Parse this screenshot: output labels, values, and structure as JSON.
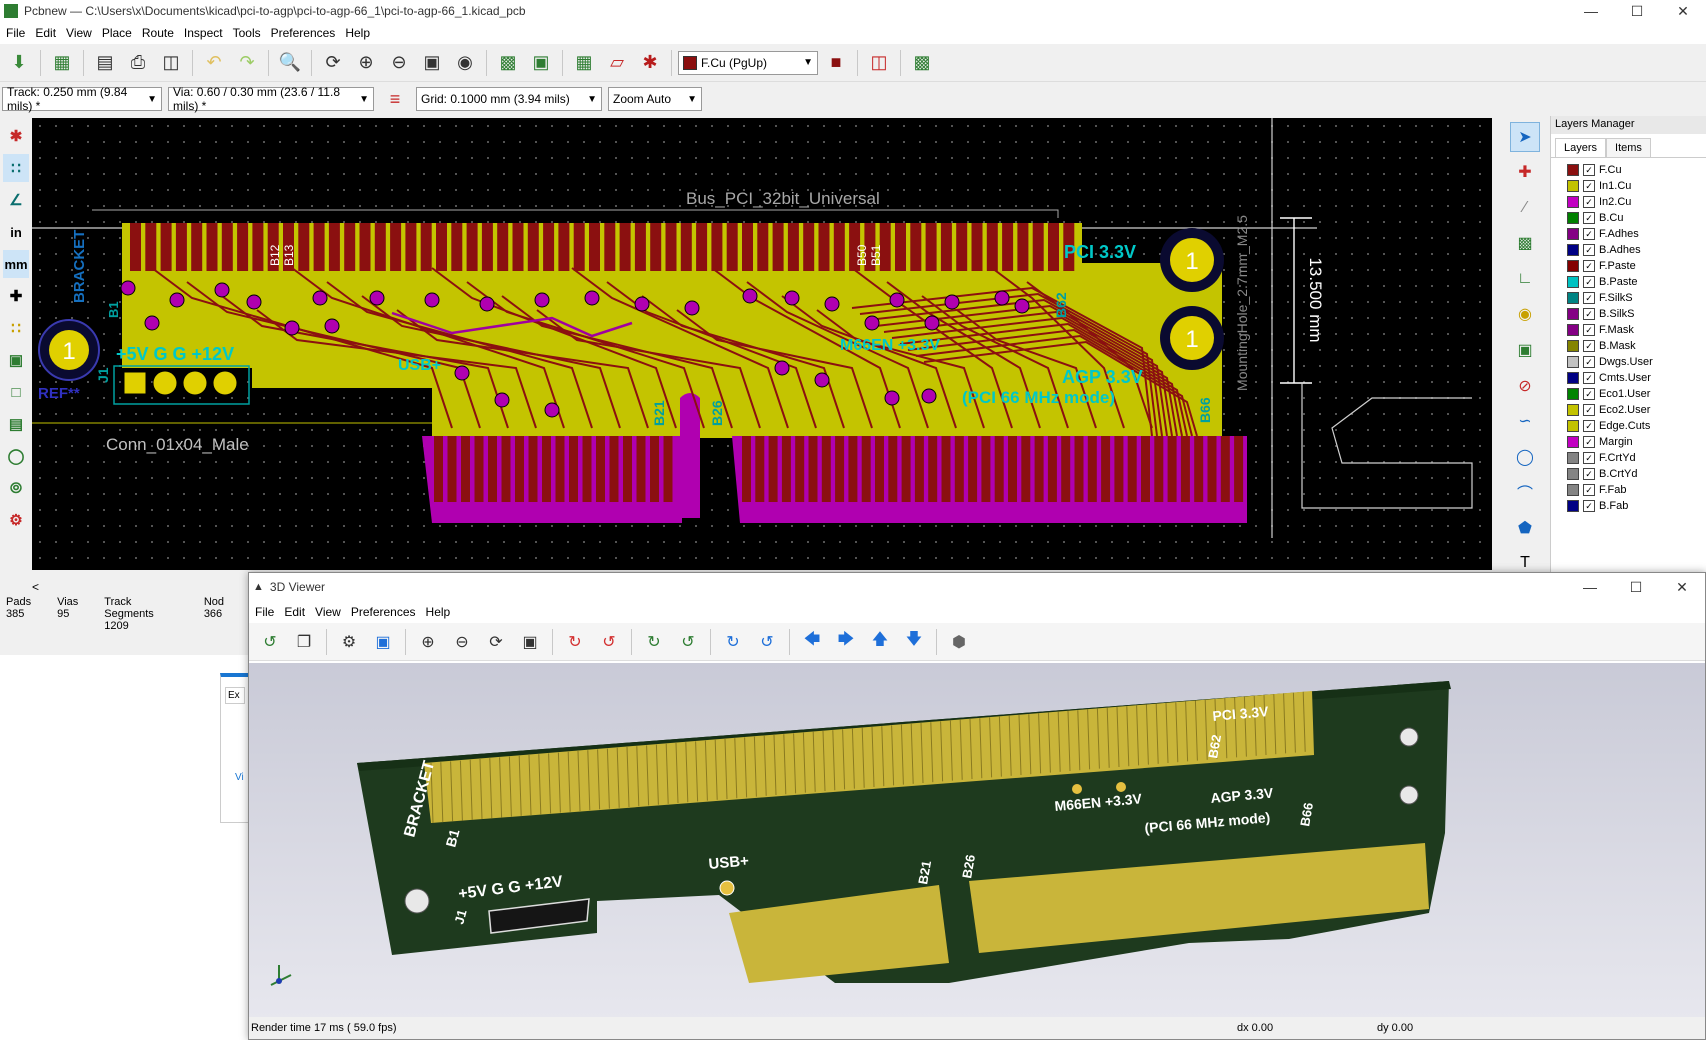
{
  "pcbnew": {
    "title": "Pcbnew — C:\\Users\\x\\Documents\\kicad\\pci-to-agp\\pci-to-agp-66_1\\pci-to-agp-66_1.kicad_pcb",
    "menu": [
      "File",
      "Edit",
      "View",
      "Place",
      "Route",
      "Inspect",
      "Tools",
      "Preferences",
      "Help"
    ],
    "layer_select": "F.Cu (PgUp)",
    "track": "Track: 0.250 mm (9.84 mils) *",
    "via": "Via: 0.60 / 0.30 mm (23.6 / 11.8 mils) *",
    "grid": "Grid: 0.1000 mm (3.94 mils)",
    "zoom": "Zoom Auto",
    "left_tools": {
      "in_label": "in",
      "mm_label": "mm"
    },
    "status": [
      {
        "label": "Pads",
        "value": "385"
      },
      {
        "label": "Vias",
        "value": "95"
      },
      {
        "label": "Track Segments",
        "value": "1209"
      },
      {
        "label": "Nod",
        "value": "366"
      }
    ],
    "scroll_arrow": "<"
  },
  "board_labels": {
    "bus": "Bus_PCI_32bit_Universal",
    "bracket": "A\n|\nBRACKET",
    "power": "+5V G G +12V",
    "j1": "J1",
    "conn": "Conn_01x04_Male",
    "ref": "REF**",
    "pci33": "PCI 3.3V",
    "agp33": "AGP 3.3V",
    "pci66": "(PCI 66 MHz mode)",
    "m66en": "M66EN +3.3V",
    "usb": "USB+",
    "dim": "13.500 mm",
    "hole": "MountingHole_2.7mm_M2.5",
    "b1": "B1",
    "b12": "B12",
    "b13": "B13",
    "b21": "B21",
    "b26": "B26",
    "b50": "B50",
    "b51": "B51",
    "b62": "B62",
    "b66": "B66",
    "one": "1"
  },
  "layers_manager": {
    "title": "Layers Manager",
    "tabs": [
      "Layers",
      "Items"
    ],
    "layers": [
      {
        "name": "F.Cu",
        "color": "#8b1010"
      },
      {
        "name": "In1.Cu",
        "color": "#c2c200"
      },
      {
        "name": "In2.Cu",
        "color": "#c200c2"
      },
      {
        "name": "B.Cu",
        "color": "#008000"
      },
      {
        "name": "F.Adhes",
        "color": "#840084"
      },
      {
        "name": "B.Adhes",
        "color": "#000084"
      },
      {
        "name": "F.Paste",
        "color": "#840000"
      },
      {
        "name": "B.Paste",
        "color": "#00c2c2"
      },
      {
        "name": "F.SilkS",
        "color": "#008484"
      },
      {
        "name": "B.SilkS",
        "color": "#840084"
      },
      {
        "name": "F.Mask",
        "color": "#840084"
      },
      {
        "name": "B.Mask",
        "color": "#848400"
      },
      {
        "name": "Dwgs.User",
        "color": "#c2c2c2"
      },
      {
        "name": "Cmts.User",
        "color": "#000084"
      },
      {
        "name": "Eco1.User",
        "color": "#008400"
      },
      {
        "name": "Eco2.User",
        "color": "#c2c200"
      },
      {
        "name": "Edge.Cuts",
        "color": "#c2c200"
      },
      {
        "name": "Margin",
        "color": "#c200c2"
      },
      {
        "name": "F.CrtYd",
        "color": "#848484"
      },
      {
        "name": "B.CrtYd",
        "color": "#848484"
      },
      {
        "name": "F.Fab",
        "color": "#848484"
      },
      {
        "name": "B.Fab",
        "color": "#000084"
      }
    ]
  },
  "viewer": {
    "title": "3D Viewer",
    "menu": [
      "File",
      "Edit",
      "View",
      "Preferences",
      "Help"
    ],
    "status": "Render time 17 ms ( 59.0 fps)",
    "dx": "dx 0.00",
    "dy": "dy 0.00"
  },
  "board3d_labels": {
    "bracket": "A\n|\nBRACKET",
    "b1": "B1",
    "power": "+5V G G +12V",
    "j1": "J1",
    "usb": "USB+",
    "b21": "B21",
    "b26": "B26",
    "m66en": "M66EN +3.3V",
    "agp": "AGP 3.3V",
    "pci66": "(PCI 66 MHz mode)",
    "b66": "B66",
    "b62": "B62",
    "pci33": "PCI 3.3V"
  },
  "desk_stub": {
    "text1": "Ex",
    "text2": "Vi"
  }
}
